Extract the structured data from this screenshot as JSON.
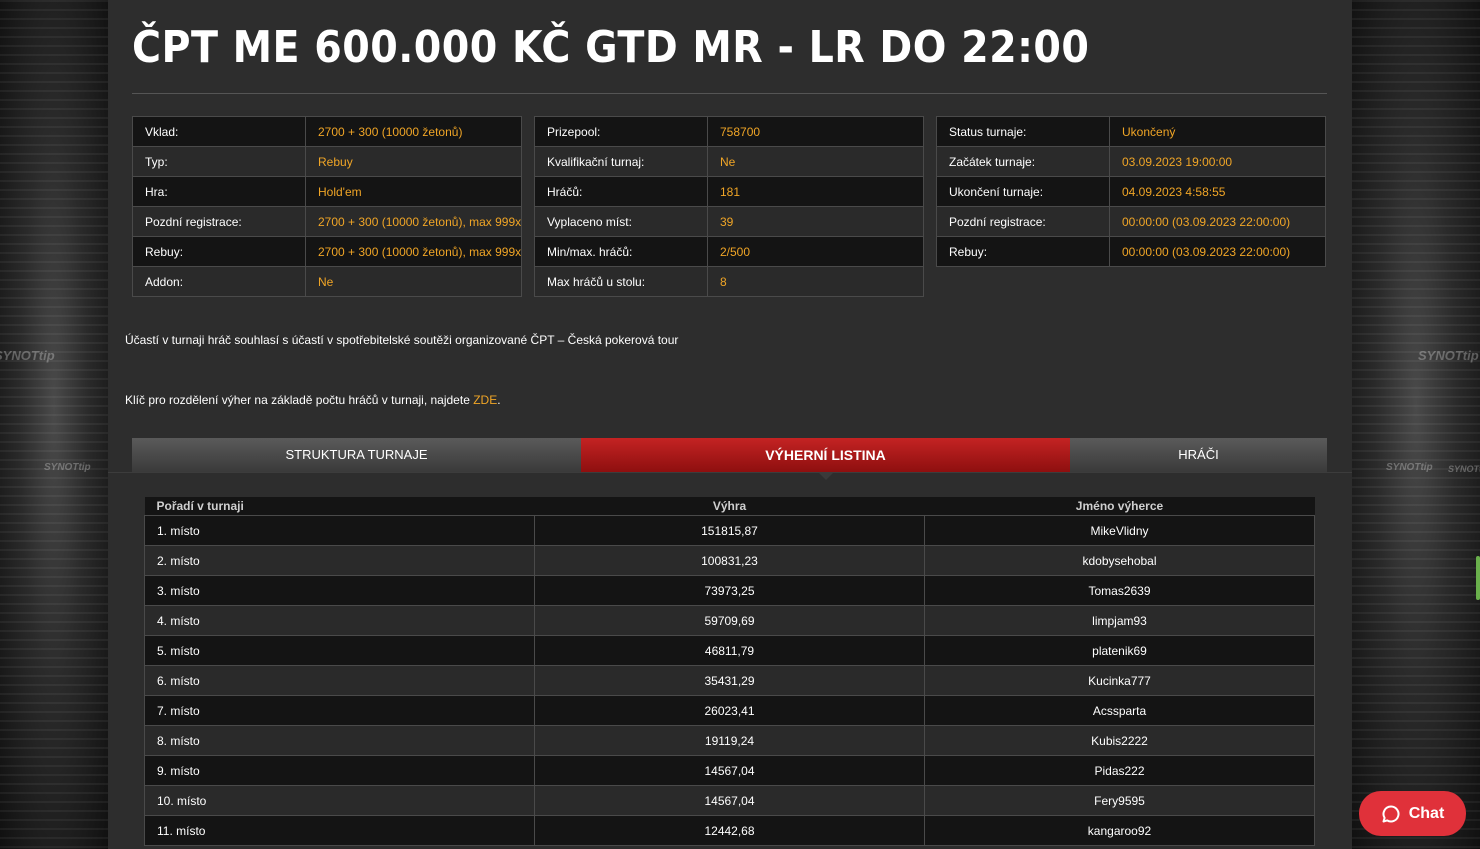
{
  "title": "ČPT ME 600.000 KČ GTD MR - LR DO 22:00",
  "watermark": "SYNOTtip",
  "info_tables": [
    [
      {
        "k": "Vklad:",
        "v": "2700 + 300 (10000 žetonů)"
      },
      {
        "k": "Typ:",
        "v": "Rebuy"
      },
      {
        "k": "Hra:",
        "v": "Hold'em"
      },
      {
        "k": "Pozdní registrace:",
        "v": "2700 + 300 (10000 žetonů), max 999x"
      },
      {
        "k": "Rebuy:",
        "v": "2700 + 300 (10000 žetonů), max 999x"
      },
      {
        "k": "Addon:",
        "v": "Ne"
      }
    ],
    [
      {
        "k": "Prizepool:",
        "v": "758700"
      },
      {
        "k": "Kvalifikační turnaj:",
        "v": "Ne"
      },
      {
        "k": "Hráčů:",
        "v": "181"
      },
      {
        "k": "Vyplaceno míst:",
        "v": "39"
      },
      {
        "k": "Min/max. hráčů:",
        "v": "2/500"
      },
      {
        "k": "Max hráčů u stolu:",
        "v": "8"
      }
    ],
    [
      {
        "k": "Status turnaje:",
        "v": "Ukončený"
      },
      {
        "k": "Začátek turnaje:",
        "v": "03.09.2023 19:00:00"
      },
      {
        "k": "Ukončení turnaje:",
        "v": "04.09.2023 4:58:55"
      },
      {
        "k": "Pozdní registrace:",
        "v": "00:00:00 (03.09.2023 22:00:00)"
      },
      {
        "k": "Rebuy:",
        "v": "00:00:00 (03.09.2023 22:00:00)"
      }
    ]
  ],
  "notes": {
    "consent": "Účastí v turnaji hráč souhlasí s účastí v spotřebitelské soutěži organizované ČPT – Česká pokerová tour",
    "key_prefix": "Klíč pro rozdělení výher na základě počtu hráčů v turnaji, najdete ",
    "key_link": "ZDE",
    "key_suffix": "."
  },
  "tabs": [
    {
      "label": "STRUKTURA TURNAJE",
      "active": false
    },
    {
      "label": "VÝHERNÍ LISTINA",
      "active": true
    },
    {
      "label": "HRÁČI",
      "active": false
    }
  ],
  "results": {
    "headers": [
      "Pořadí v turnaji",
      "Výhra",
      "Jméno výherce"
    ],
    "rows": [
      [
        "1. místo",
        "151815,87",
        "MikeVlidny"
      ],
      [
        "2. místo",
        "100831,23",
        "kdobysehobal"
      ],
      [
        "3. místo",
        "73973,25",
        "Tomas2639"
      ],
      [
        "4. místo",
        "59709,69",
        "limpjam93"
      ],
      [
        "5. místo",
        "46811,79",
        "platenik69"
      ],
      [
        "6. místo",
        "35431,29",
        "Kucinka777"
      ],
      [
        "7. místo",
        "26023,41",
        "Acssparta"
      ],
      [
        "8. místo",
        "19119,24",
        "Kubis2222"
      ],
      [
        "9. místo",
        "14567,04",
        "Pidas222"
      ],
      [
        "10. místo",
        "14567,04",
        "Fery9595"
      ],
      [
        "11. místo",
        "12442,68",
        "kangaroo92"
      ]
    ]
  },
  "chat": {
    "label": "Chat",
    "icon": "chat-bubble-icon"
  },
  "colors": {
    "accent": "#f0a526",
    "active_tab": "#b51b1b",
    "chat": "#e0313a"
  }
}
